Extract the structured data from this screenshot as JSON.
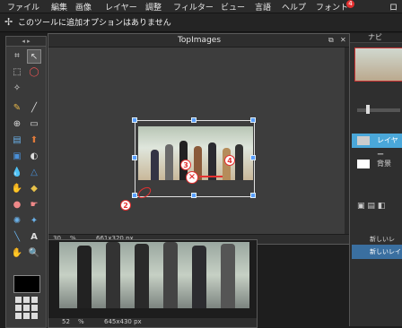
{
  "menubar": {
    "items": [
      "ファイル",
      "編集",
      "画像",
      "レイヤー",
      "調整",
      "フィルター",
      "ビュー",
      "言語",
      "ヘルプ",
      "フォント",
      "ロ"
    ],
    "font_badge": "4"
  },
  "options_bar": {
    "message": "このツールに追加オプションはありません"
  },
  "document_window": {
    "title": "TopImages",
    "zoom": "30",
    "zoom_unit": "%",
    "dimensions": "661x320 px"
  },
  "document_window_2": {
    "zoom": "52",
    "zoom_unit": "%",
    "dimensions": "645x430 px"
  },
  "right_panel": {
    "navigator_label": "ナビ",
    "layer_main_label": "レイヤー",
    "layer_bg_label": "背景",
    "new_layer_label": "新しいレ",
    "new_layer_label_2": "新しいレイ"
  },
  "annotations": {
    "two": "2",
    "three": "3",
    "four": "4",
    "x": "×"
  },
  "colors": {
    "accent": "#5aa0ff",
    "annotation": "#e53030",
    "selected_layer": "#4aa7d9"
  }
}
